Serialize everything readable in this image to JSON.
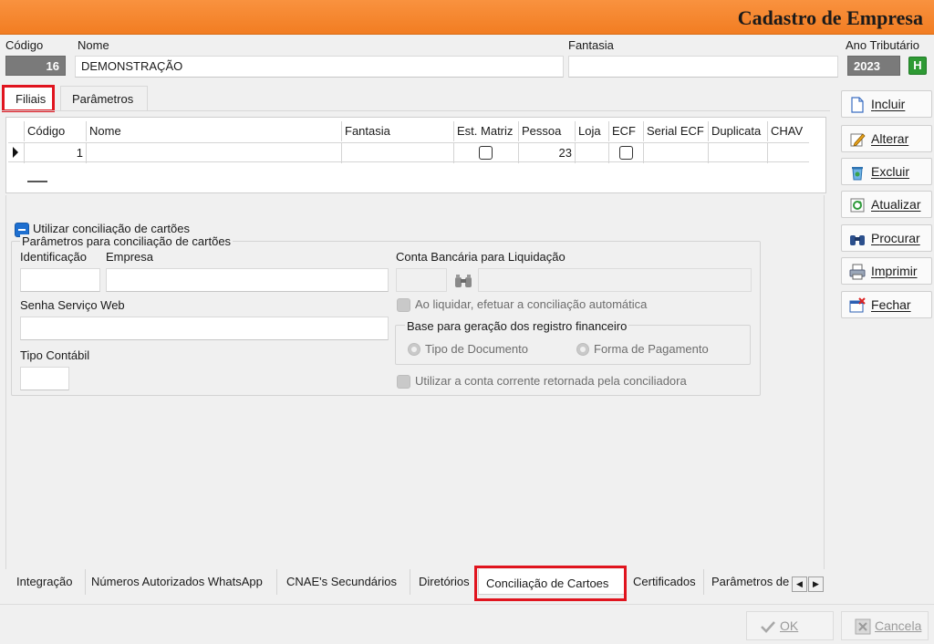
{
  "window": {
    "title": "Cadastro de Empresa"
  },
  "header": {
    "codigo_label": "Código",
    "codigo_value": "16",
    "nome_label": "Nome",
    "nome_value": "DEMONSTRAÇÃO",
    "fantasia_label": "Fantasia",
    "fantasia_value": "",
    "ano_label": "Ano Tributário",
    "ano_value": "2023",
    "ano_badge": "H"
  },
  "top_tabs": [
    {
      "label": "Filiais",
      "active": true
    },
    {
      "label": "Parâmetros",
      "active": false
    }
  ],
  "grid": {
    "columns": [
      "Código",
      "Nome",
      "Fantasia",
      "Est. Matriz",
      "Pessoa",
      "Loja",
      "ECF",
      "Serial ECF",
      "Duplicata",
      "CHAV"
    ],
    "rows": [
      {
        "codigo": "1",
        "nome": "",
        "fantasia": "",
        "est_matriz": false,
        "pessoa": "23",
        "loja": "",
        "ecf": false,
        "serial_ecf": "",
        "duplicata": "",
        "chav": ""
      }
    ]
  },
  "conciliacao": {
    "utilizar_label": "Utilizar conciliação de cartões",
    "group_title": "Parâmetros para conciliação de cartões",
    "identificacao_label": "Identificação",
    "empresa_label": "Empresa",
    "senha_label": "Senha Serviço Web",
    "tipo_contabil_label": "Tipo Contábil",
    "conta_label": "Conta Bancária para Liquidação",
    "ao_liquidar_label": "Ao liquidar, efetuar a conciliação automática",
    "base_title": "Base para geração dos registro financeiro",
    "radio_tipo_doc": "Tipo de Documento",
    "radio_forma_pag": "Forma de Pagamento",
    "utilizar_conta_label": "Utilizar a conta corrente retornada pela conciliadora"
  },
  "bottom_tabs": [
    {
      "label": "Integração"
    },
    {
      "label": "Números Autorizados WhatsApp"
    },
    {
      "label": "CNAE's Secundários"
    },
    {
      "label": "Diretórios"
    },
    {
      "label": "Conciliação de Cartoes",
      "active": true
    },
    {
      "label": "Certificados"
    },
    {
      "label": "Parâmetros de"
    }
  ],
  "scroll": {
    "left": "◀",
    "right": "▶"
  },
  "side_buttons": [
    {
      "key": "incluir",
      "first": "I",
      "rest": "ncluir",
      "icon": "document-icon"
    },
    {
      "key": "alterar",
      "first": "A",
      "rest": "lterar",
      "icon": "edit-icon"
    },
    {
      "key": "excluir",
      "first": "E",
      "rest": "xcluir",
      "icon": "recycle-bin-icon"
    },
    {
      "key": "atualizar",
      "first": "A",
      "rest": "tualizar",
      "icon": "refresh-icon"
    },
    {
      "key": "procurar",
      "first": "P",
      "rest": "rocurar",
      "icon": "binoculars-icon"
    },
    {
      "key": "imprimir",
      "first": "I",
      "rest": "mprimir",
      "icon": "printer-icon"
    },
    {
      "key": "fechar",
      "first": "F",
      "rest": "echar",
      "icon": "close-window-icon"
    }
  ],
  "footer": {
    "ok_label": "OK",
    "cancel_label": "Cancela"
  },
  "colors": {
    "title_bar": "#f27d22",
    "highlight": "#e0141e",
    "accent_blue": "#1e6fd0",
    "badge_green": "#2e9a34"
  }
}
